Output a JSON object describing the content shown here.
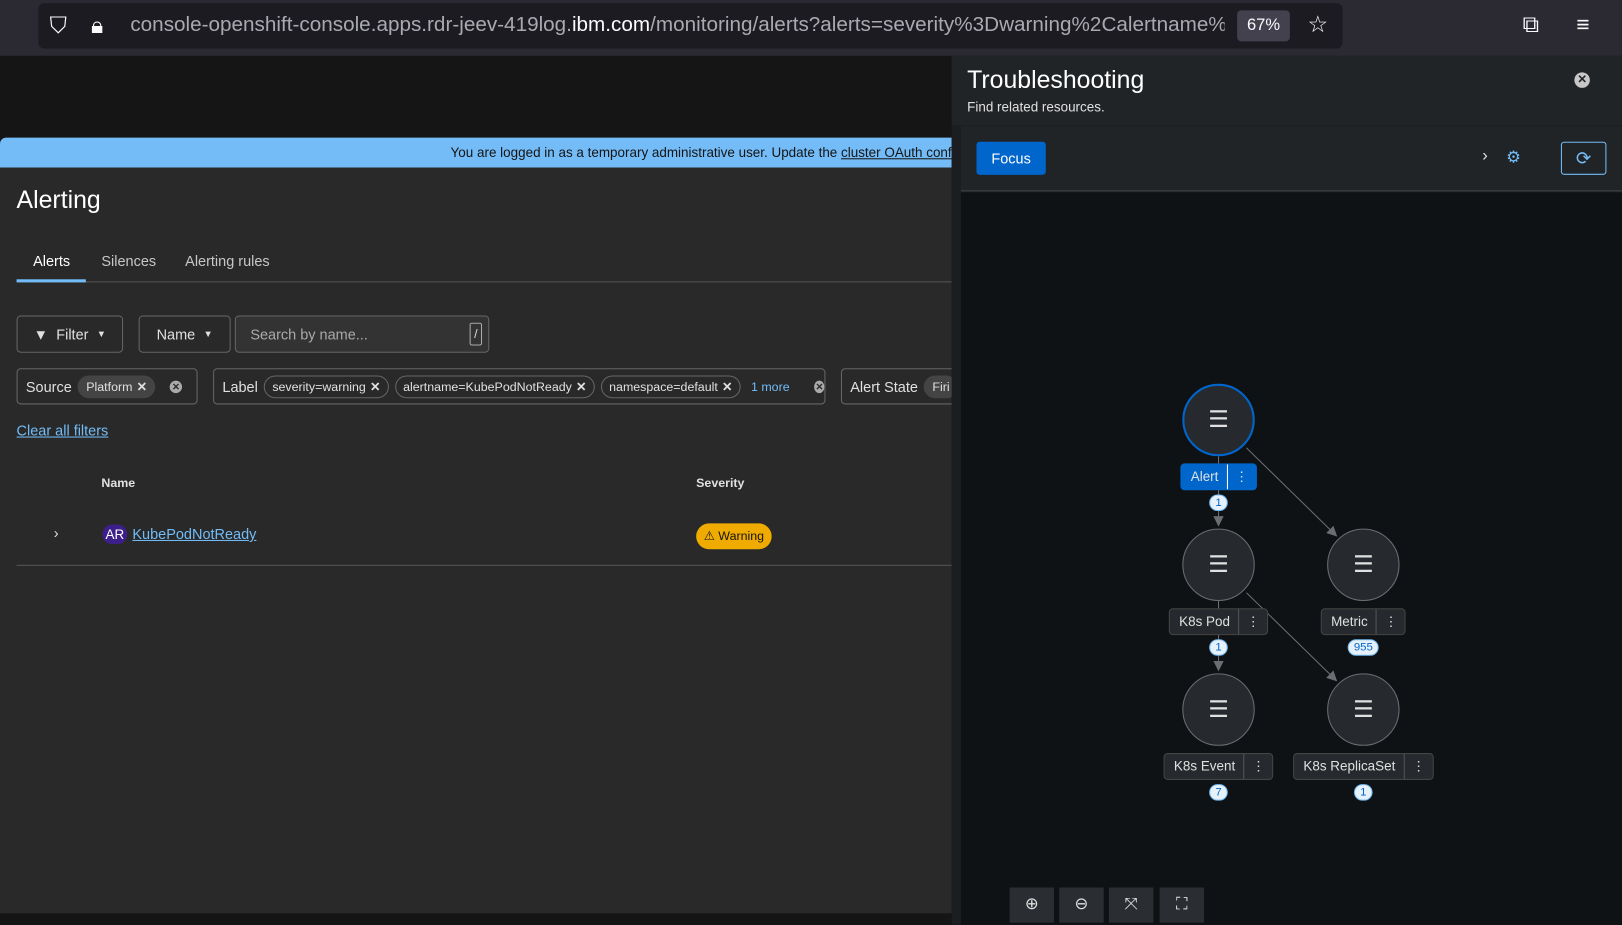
{
  "browser": {
    "url_pre": "console-openshift-console.apps.rdr-jeev-419log.",
    "url_domain": "ibm.com",
    "url_post": "/monitoring/alerts?alerts=severity%3Dwarning%2Calertname%",
    "zoom": "67%"
  },
  "banner": {
    "text": "You are logged in as a temporary administrative user. Update the ",
    "link": "cluster OAuth conf"
  },
  "page": {
    "title": "Alerting",
    "tabs": [
      "Alerts",
      "Silences",
      "Alerting rules"
    ]
  },
  "toolbar": {
    "filter": "Filter",
    "name": "Name",
    "search_placeholder": "Search by name...",
    "slash": "/"
  },
  "filters": {
    "source_label": "Source",
    "source_chips": [
      "Platform"
    ],
    "label_label": "Label",
    "label_chips": [
      "severity=warning",
      "alertname=KubePodNotReady",
      "namespace=default"
    ],
    "more": "1 more",
    "state_label": "Alert State",
    "state_chip": "Firi",
    "clear": "Clear all filters"
  },
  "table": {
    "headers": [
      "Name",
      "Severity"
    ],
    "rows": [
      {
        "badge": "AR",
        "name": "KubePodNotReady",
        "severity": "Warning"
      }
    ]
  },
  "panel": {
    "title": "Troubleshooting",
    "subtitle": "Find related resources.",
    "focus": "Focus",
    "nodes": [
      {
        "label": "Alert",
        "count": "1"
      },
      {
        "label": "K8s Pod",
        "count": "1"
      },
      {
        "label": "Metric",
        "count": "955"
      },
      {
        "label": "K8s Event",
        "count": "7"
      },
      {
        "label": "K8s ReplicaSet",
        "count": "1"
      }
    ]
  },
  "colors": {
    "accent": "#0066cc",
    "link": "#73bcf7",
    "warning": "#f0ab00"
  }
}
